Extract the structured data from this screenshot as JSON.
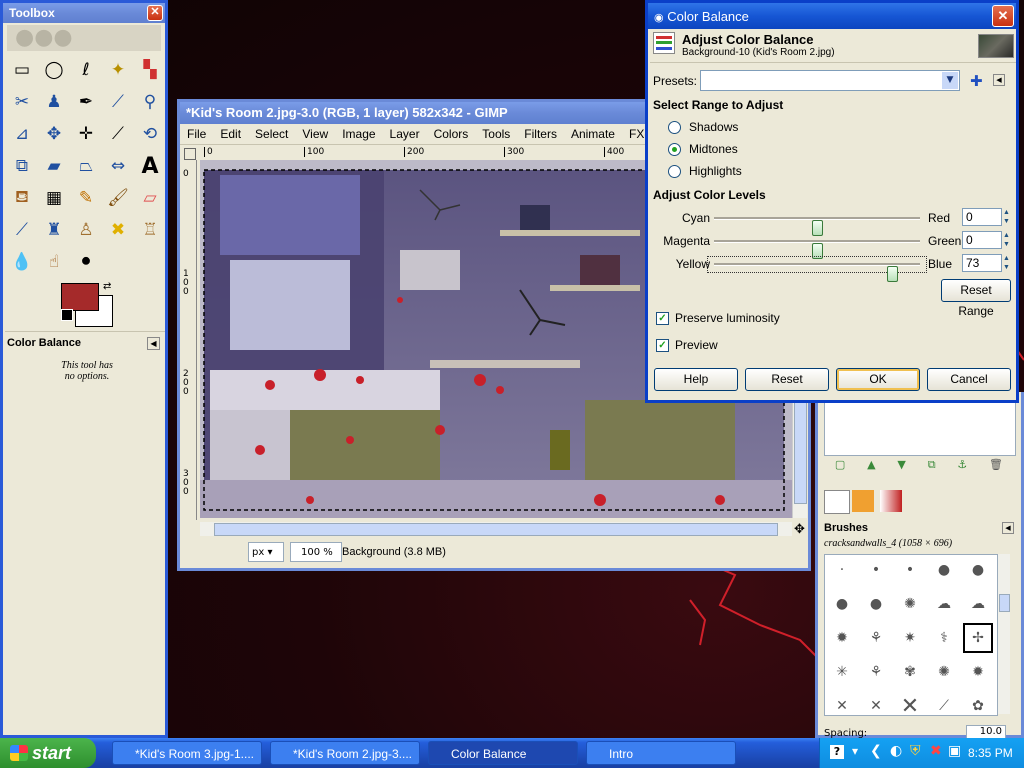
{
  "toolbox": {
    "title": "Toolbox",
    "options_title": "Color Balance",
    "options_text_1": "This tool has",
    "options_text_2": "no options.",
    "fg_color": "#a52a2a",
    "bg_color": "#ffffff"
  },
  "image_window": {
    "title": "*Kid's Room 2.jpg-3.0 (RGB, 1 layer) 582x342 - GIMP",
    "menu": [
      "File",
      "Edit",
      "Select",
      "View",
      "Image",
      "Layer",
      "Colors",
      "Tools",
      "Filters",
      "Animate",
      "FX-Foundry"
    ],
    "ruler_ticks": [
      "0",
      "100",
      "200",
      "300",
      "400"
    ],
    "vruler_ticks": [
      "0",
      "1 0 0",
      "2 0 0",
      "3 0 0"
    ],
    "unit": "px",
    "zoom": "100 %",
    "status": "Background (3.8 MB)"
  },
  "color_balance": {
    "title": "Color Balance",
    "header_title": "Adjust Color Balance",
    "header_sub": "Background-10 (Kid's Room 2.jpg)",
    "presets_label": "Presets:",
    "presets_value": "",
    "range_heading": "Select Range to Adjust",
    "ranges": [
      {
        "label": "Shadows",
        "selected": false
      },
      {
        "label": "Midtones",
        "selected": true
      },
      {
        "label": "Highlights",
        "selected": false
      }
    ],
    "levels_heading": "Adjust Color Levels",
    "sliders": [
      {
        "left": "Cyan",
        "right": "Red",
        "value": "0",
        "level": 0
      },
      {
        "left": "Magenta",
        "right": "Green",
        "value": "0",
        "level": 0
      },
      {
        "left": "Yellow",
        "right": "Blue",
        "value": "73",
        "level": 73
      }
    ],
    "reset_range": "Reset Range",
    "preserve_luminosity": "Preserve luminosity",
    "preview": "Preview",
    "buttons": {
      "help": "Help",
      "reset": "Reset",
      "ok": "OK",
      "cancel": "Cancel"
    }
  },
  "brushes": {
    "title": "Brushes",
    "selected": "cracksandwalls_4 (1058 × 696)",
    "spacing_label": "Spacing:",
    "spacing_value": "10.0"
  },
  "taskbar": {
    "start": "start",
    "items": [
      {
        "label": "*Kid's Room 3.jpg-1....",
        "active": false
      },
      {
        "label": "*Kid's Room 2.jpg-3....",
        "active": false
      },
      {
        "label": "Color Balance",
        "active": true
      },
      {
        "label": "Intro",
        "active": false
      }
    ],
    "clock": "8:35 PM"
  }
}
